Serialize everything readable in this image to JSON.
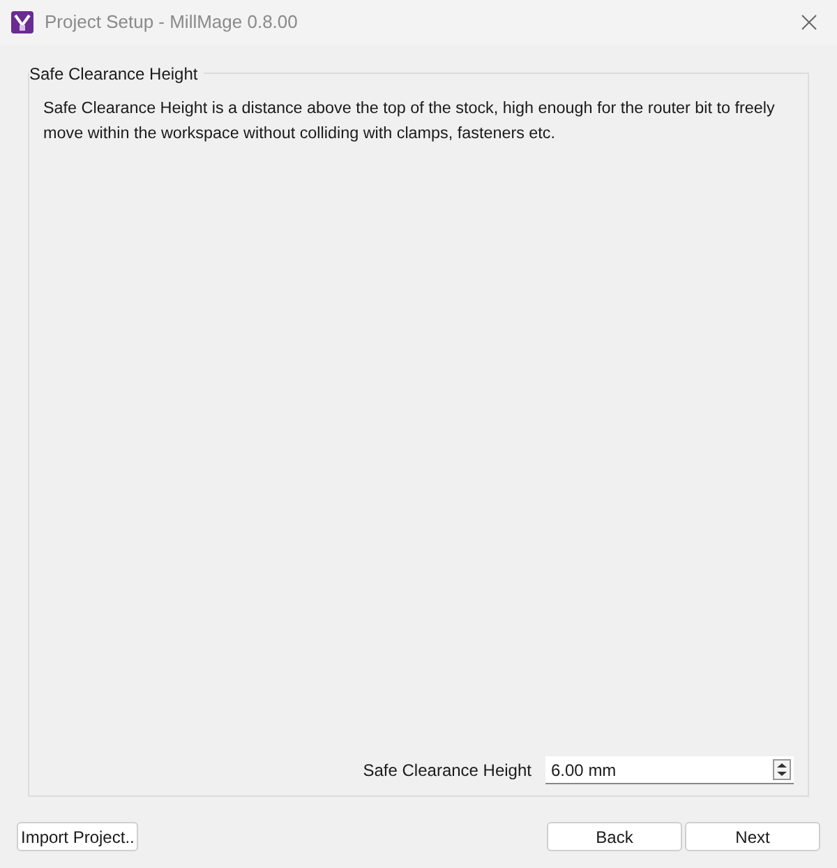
{
  "window": {
    "title": "Project Setup - MillMage 0.8.00"
  },
  "group": {
    "title": "Safe Clearance Height",
    "description": "Safe Clearance Height is a distance above the top of the stock, high enough for the router bit to freely move within the workspace without colliding with clamps, fasteners etc.",
    "field": {
      "label": "Safe Clearance Height",
      "value": "6.00 mm"
    }
  },
  "buttons": {
    "import": "Import Project..",
    "back": "Back",
    "next": "Next"
  }
}
